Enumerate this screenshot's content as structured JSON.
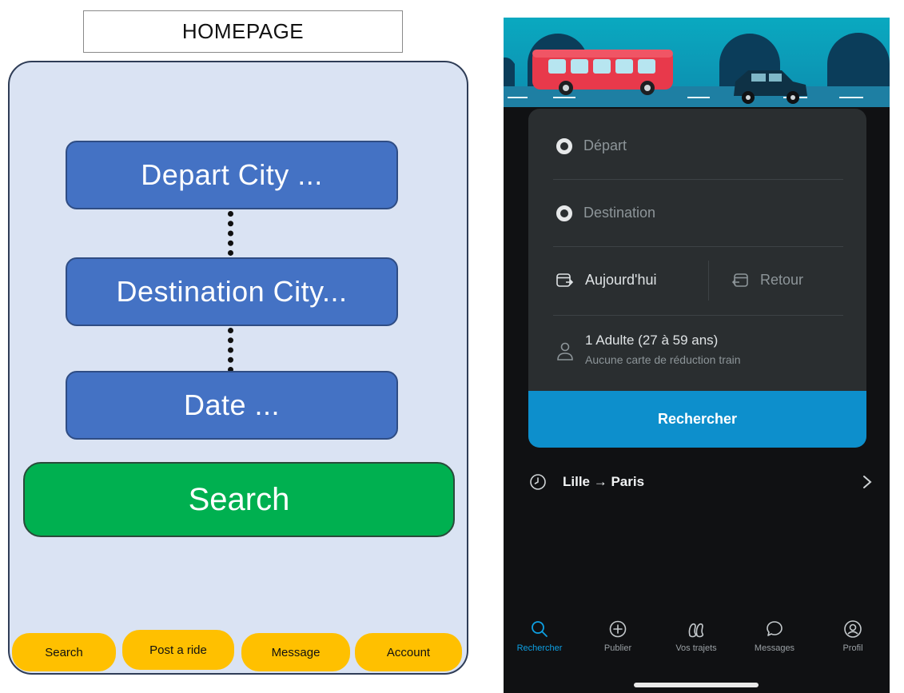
{
  "wireframe": {
    "title": "HOMEPAGE",
    "fields": {
      "depart": "Depart City ...",
      "destination": "Destination City...",
      "date": "Date ..."
    },
    "search_button": "Search",
    "tabs": [
      "Search",
      "Post a ride",
      "Message",
      "Account"
    ],
    "colors": {
      "background": "#dae3f3",
      "field": "#4472c4",
      "search": "#00b050",
      "tab": "#ffc000"
    }
  },
  "app": {
    "form": {
      "depart_placeholder": "Départ",
      "destination_placeholder": "Destination",
      "date_value": "Aujourd'hui",
      "return_label": "Retour",
      "passengers": "1 Adulte (27 à 59 ans)",
      "passengers_note": "Aucune carte de réduction train",
      "search_button": "Rechercher"
    },
    "recent_search": "Lille → Paris",
    "tabs": [
      {
        "label": "Rechercher",
        "icon": "search-icon",
        "active": true
      },
      {
        "label": "Publier",
        "icon": "plus-circle-icon",
        "active": false
      },
      {
        "label": "Vos trajets",
        "icon": "trips-icon",
        "active": false
      },
      {
        "label": "Messages",
        "icon": "chat-bubble-icon",
        "active": false
      },
      {
        "label": "Profil",
        "icon": "profile-icon",
        "active": false
      }
    ],
    "colors": {
      "accent": "#0d8fcc",
      "card": "#2a2e30",
      "background": "#101113"
    }
  }
}
